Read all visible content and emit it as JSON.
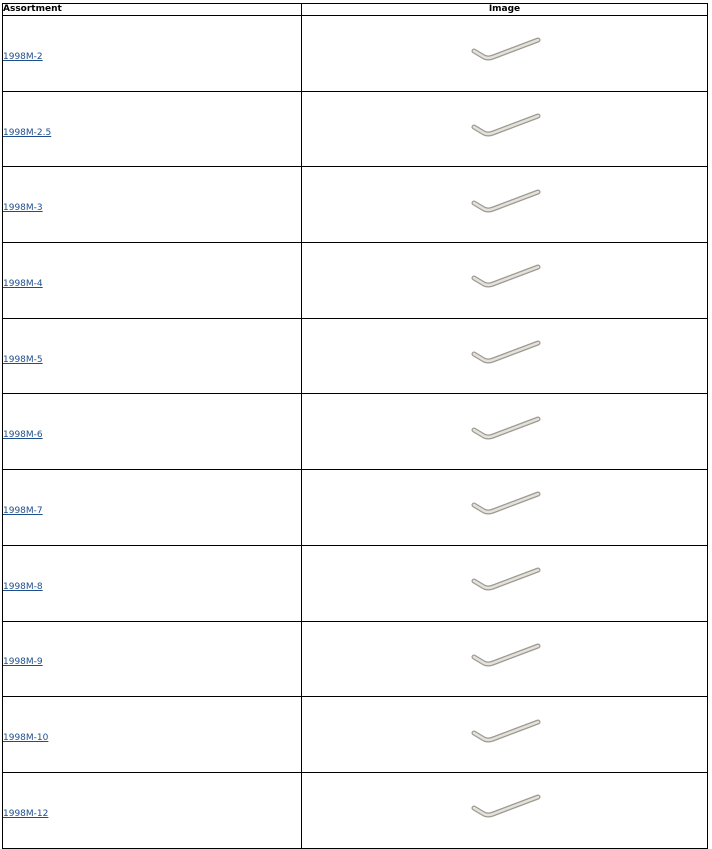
{
  "table": {
    "headers": {
      "assortment": "Assortment",
      "image": "Image"
    },
    "rows": [
      {
        "part": "1998M-2",
        "icon": "hex-key-icon"
      },
      {
        "part": "1998M-2.5",
        "icon": "hex-key-icon"
      },
      {
        "part": "1998M-3",
        "icon": "hex-key-icon"
      },
      {
        "part": "1998M-4",
        "icon": "hex-key-icon"
      },
      {
        "part": "1998M-5",
        "icon": "hex-key-icon"
      },
      {
        "part": "1998M-6",
        "icon": "hex-key-icon"
      },
      {
        "part": "1998M-7",
        "icon": "hex-key-icon"
      },
      {
        "part": "1998M-8",
        "icon": "hex-key-icon"
      },
      {
        "part": "1998M-9",
        "icon": "hex-key-icon"
      },
      {
        "part": "1998M-10",
        "icon": "hex-key-icon"
      },
      {
        "part": "1998M-12",
        "icon": "hex-key-icon"
      }
    ]
  },
  "colors": {
    "link": "#1f4e8c",
    "border": "#000000",
    "tool_steel": "#c9c6bd"
  }
}
